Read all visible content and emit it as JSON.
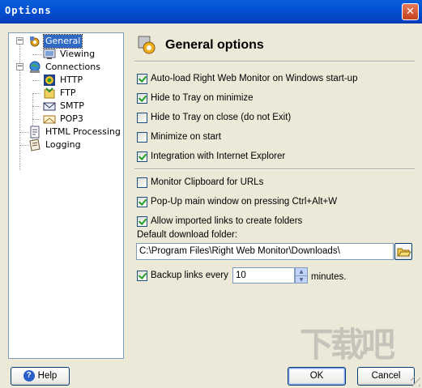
{
  "window": {
    "title": "Options",
    "close_glyph": "✕"
  },
  "tree": {
    "items": [
      {
        "label": "General",
        "icon": "general-settings-icon",
        "selected": true
      },
      {
        "label": "Viewing",
        "icon": "monitor-icon"
      },
      {
        "label": "Connections",
        "icon": "globe-network-icon"
      },
      {
        "label": "HTTP",
        "icon": "http-icon"
      },
      {
        "label": "FTP",
        "icon": "ftp-icon"
      },
      {
        "label": "SMTP",
        "icon": "smtp-icon"
      },
      {
        "label": "POP3",
        "icon": "pop3-icon"
      },
      {
        "label": "HTML Processing",
        "icon": "html-processing-icon"
      },
      {
        "label": "Logging",
        "icon": "logging-icon"
      }
    ]
  },
  "header": {
    "title": "General options",
    "icon": "general-options-icon"
  },
  "options": [
    {
      "label": "Auto-load Right Web Monitor on Windows start-up",
      "checked": true
    },
    {
      "label": "Hide to Tray on minimize",
      "checked": true
    },
    {
      "label": "Hide to Tray on close (do not Exit)",
      "checked": false
    },
    {
      "label": "Minimize on start",
      "checked": false
    },
    {
      "label": "Integration with Internet Explorer",
      "checked": true
    },
    {
      "label": "Monitor Clipboard for URLs",
      "checked": false
    },
    {
      "label": "Pop-Up main window on pressing Ctrl+Alt+W",
      "checked": true
    },
    {
      "label": "Allow imported links to create folders",
      "checked": true
    }
  ],
  "download_folder": {
    "label": "Default download folder:",
    "value": "C:\\Program Files\\Right Web Monitor\\Downloads\\",
    "browse_icon": "folder-open-icon"
  },
  "backup": {
    "label": "Backup links every",
    "checked": true,
    "value": "10",
    "unit": "minutes."
  },
  "buttons": {
    "help": "Help",
    "ok": "OK",
    "cancel": "Cancel"
  },
  "watermark": "下载吧"
}
